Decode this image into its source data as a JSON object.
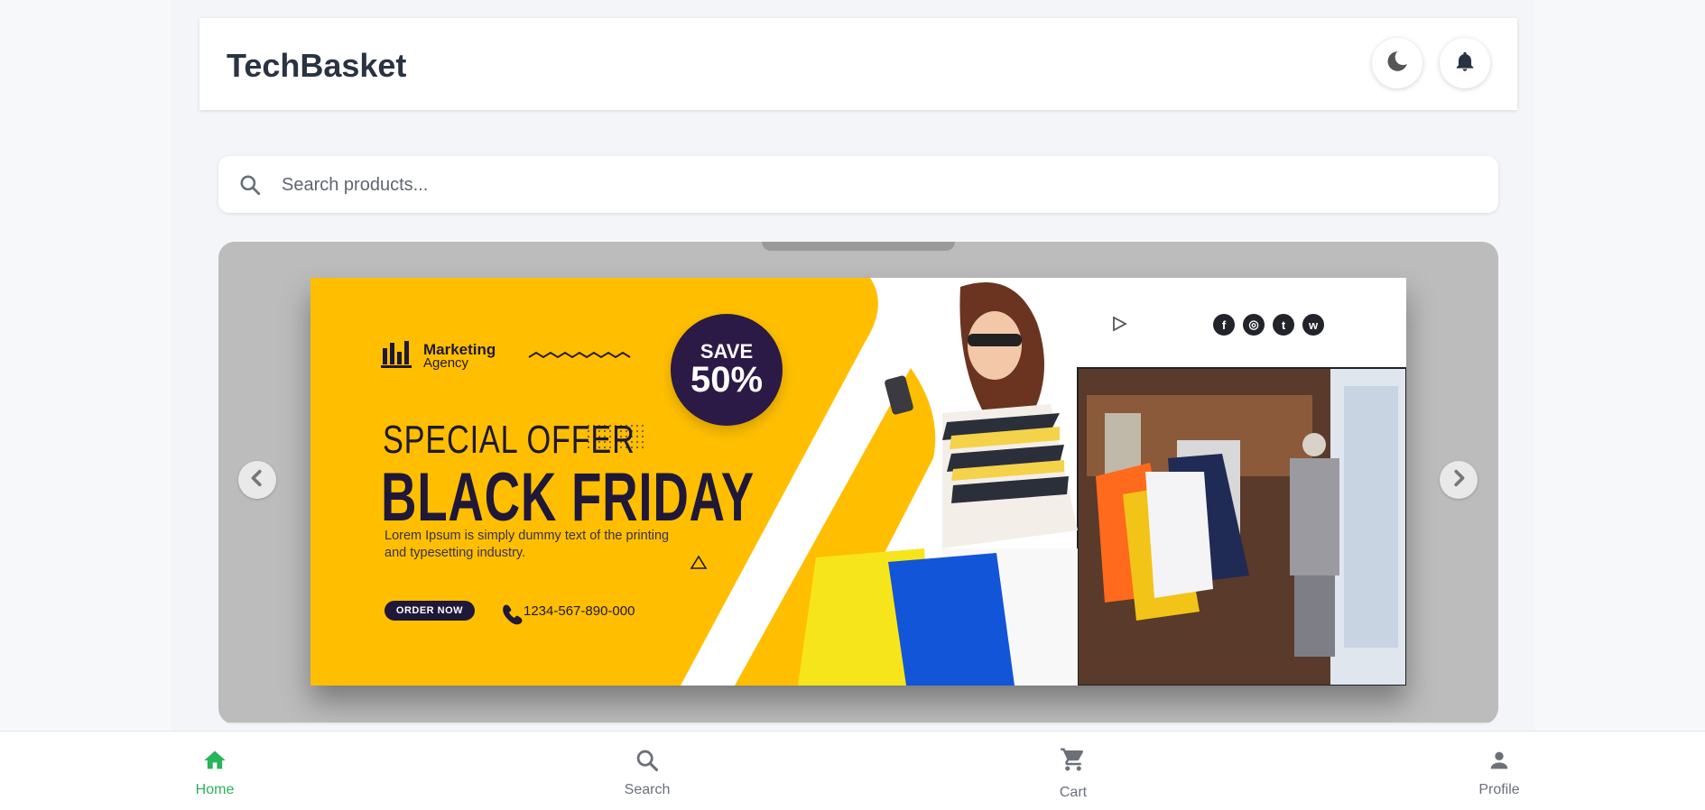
{
  "header": {
    "brand": "TechBasket",
    "theme_toggle_icon": "moon-icon",
    "notifications_icon": "bell-icon"
  },
  "search": {
    "placeholder": "Search products...",
    "icon": "search-icon"
  },
  "carousel": {
    "prev_icon": "chevron-left-icon",
    "next_icon": "chevron-right-icon",
    "banner": {
      "logo_line1": "Marketing",
      "logo_line2": "Agency",
      "badge_top": "SAVE",
      "badge_pct": "50%",
      "special": "SPECIAL OFFER",
      "headline": "BLACK FRIDAY",
      "lorem": "Lorem Ipsum is simply dummy text of the printing and typesetting industry.",
      "order_label": "ORDER NOW",
      "phone": "1234-567-890-000",
      "social": [
        "f",
        "◎",
        "t",
        "w"
      ],
      "accent_color": "#ffbf00",
      "dark_color": "#1f1838"
    }
  },
  "bottom_nav": {
    "items": [
      {
        "label": "Home",
        "icon": "home-icon",
        "active": true
      },
      {
        "label": "Search",
        "icon": "search-icon",
        "active": false
      },
      {
        "label": "Cart",
        "icon": "cart-icon",
        "active": false
      },
      {
        "label": "Profile",
        "icon": "person-icon",
        "active": false
      }
    ],
    "active_color": "#27b45a"
  }
}
